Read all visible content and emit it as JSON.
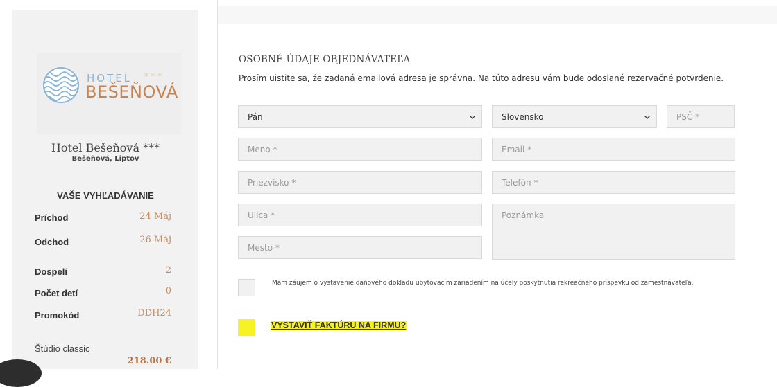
{
  "sidebar": {
    "logo": {
      "word_hotel": "HOTEL",
      "stars": "***",
      "word_name": "BEŠEŇOVÁ"
    },
    "hotel_name": "Hotel Bešeňová ***",
    "hotel_location": "Bešeňová, Liptov",
    "search_title": "VAŠE VYHĽADÁVANIE",
    "rows": [
      {
        "label": "Príchod",
        "value": "24 Máj"
      },
      {
        "label": "Odchod",
        "value": "26 Máj"
      },
      {
        "label": "Dospelí",
        "value": "2"
      },
      {
        "label": "Počet detí",
        "value": "0"
      },
      {
        "label": "Promokód",
        "value": "DDH24"
      }
    ],
    "room_name": "Štúdio classic",
    "room_price": "218.00 €"
  },
  "form": {
    "section_title": "OSOBNÉ ÚDAJE OBJEDNÁVATEĽA",
    "notice": "Prosím uistite sa, že zadaná emailová adresa je správna. Na túto adresu vám bude odoslané rezervačné potvrdenie.",
    "salutation_value": "Pán",
    "country_value": "Slovensko",
    "placeholders": {
      "zip": "PSČ *",
      "first_name": "Meno *",
      "email": "Email *",
      "last_name": "Priezvisko *",
      "phone": "Telefón *",
      "street": "Ulica *",
      "note": "Poznámka",
      "city": "Mesto *"
    },
    "consent_text": "Mám záujem o vystavenie daňového dokladu ubytovacím zariadením na účely poskytnutia rekreačného príspevku od zamestnávateľa.",
    "invoice_label": "VYSTAVIŤ FAKTÚRU NA FIRMU?"
  },
  "colors": {
    "accent_gold": "#c88a5c",
    "highlight_yellow": "#f6f224",
    "logo_blue": "#8ab4d6"
  },
  "icons": {
    "select_chevron": "chevron-down-icon",
    "logo_emblem": "wave-emblem-icon"
  }
}
